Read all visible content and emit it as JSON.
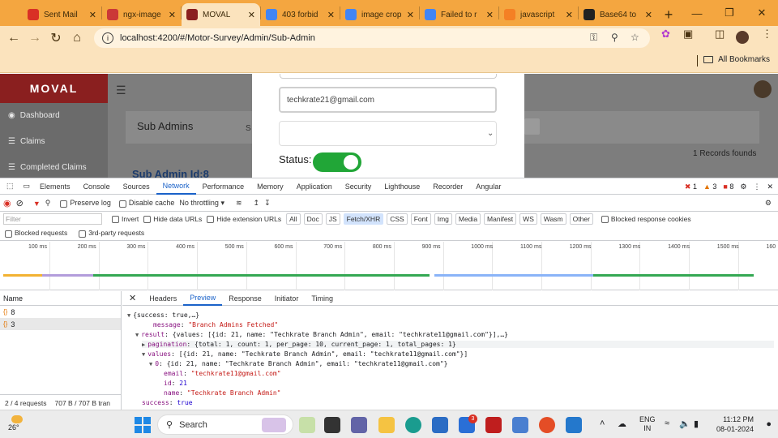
{
  "browser": {
    "tabs": [
      {
        "title": "Sent Mail",
        "icon": "gmail-icon",
        "color": "#d93025"
      },
      {
        "title": "ngx-image",
        "icon": "npm-icon",
        "color": "#cb3837"
      },
      {
        "title": "MOVAL",
        "icon": "moval-icon",
        "color": "#8a1f1f",
        "active": true
      },
      {
        "title": "403 forbid",
        "icon": "google-icon",
        "color": "#4285f4"
      },
      {
        "title": "image crop",
        "icon": "google-icon",
        "color": "#4285f4"
      },
      {
        "title": "Failed to r",
        "icon": "google-icon",
        "color": "#4285f4"
      },
      {
        "title": "javascript",
        "icon": "stackoverflow-icon",
        "color": "#f48024"
      },
      {
        "title": "Base64 to",
        "icon": "panda-icon",
        "color": "#222222"
      }
    ],
    "url": "localhost:4200/#/Motor-Survey/Admin/Sub-Admin",
    "bookmarks_label": "All Bookmarks"
  },
  "app": {
    "logo": "MOVAL",
    "sidebar": [
      "Dashboard",
      "Claims",
      "Completed Claims"
    ],
    "page_title": "Sub Admins",
    "search_prefix": "S",
    "records": "1 Records founds",
    "subadmin_heading": "Sub Admin Id:8",
    "modal": {
      "email_value": "techkrate21@gmail.com",
      "status_label": "Status:",
      "status_on": true
    }
  },
  "devtools": {
    "tabs": [
      "Elements",
      "Console",
      "Sources",
      "Network",
      "Performance",
      "Memory",
      "Application",
      "Security",
      "Lighthouse",
      "Recorder",
      "Angular"
    ],
    "active_tab": "Network",
    "errors": "1",
    "warnings": "3",
    "issues": "8",
    "toolbar": {
      "preserve_log": "Preserve log",
      "disable_cache": "Disable cache",
      "throttling": "No throttling"
    },
    "filter_placeholder": "Filter",
    "filter_opts": [
      "Invert",
      "Hide data URLs",
      "Hide extension URLs"
    ],
    "chips": [
      "All",
      "Doc",
      "JS",
      "Fetch/XHR",
      "CSS",
      "Font",
      "Img",
      "Media",
      "Manifest",
      "WS",
      "Wasm",
      "Other"
    ],
    "active_chip": "Fetch/XHR",
    "blocked_cookies": "Blocked response cookies",
    "blocked_requests": "Blocked requests",
    "third_party": "3rd-party requests",
    "timeline_ticks": [
      "100 ms",
      "200 ms",
      "300 ms",
      "400 ms",
      "500 ms",
      "600 ms",
      "700 ms",
      "800 ms",
      "900 ms",
      "1000 ms",
      "1100 ms",
      "1200 ms",
      "1300 ms",
      "1400 ms",
      "1500 ms",
      "160"
    ],
    "name_header": "Name",
    "requests": [
      "8",
      "3"
    ],
    "footer": {
      "requests": "2 / 4 requests",
      "transferred": "707 B / 707 B tran"
    },
    "detail_tabs": [
      "Headers",
      "Preview",
      "Response",
      "Initiator",
      "Timing"
    ],
    "active_detail": "Preview",
    "preview": {
      "l0": "{success: true,…}",
      "l1_key": "message",
      "l1_val": "\"Branch Admins Fetched\"",
      "l2_key": "result",
      "l2_val": "{values: [{id: 21, name: \"Techkrate Branch Admin\", email: \"techkrate11@gmail.com\"}],…}",
      "l3_key": "pagination",
      "l3_val": "{total: 1, count: 1, per_page: 10, current_page: 1, total_pages: 1}",
      "l4_key": "values",
      "l4_val": "[{id: 21, name: \"Techkrate Branch Admin\", email: \"techkrate11@gmail.com\"}]",
      "l5_key": "0",
      "l5_val": "{id: 21, name: \"Techkrate Branch Admin\", email: \"techkrate11@gmail.com\"}",
      "l6_key": "email",
      "l6_val": "\"techkrate11@gmail.com\"",
      "l7_key": "id",
      "l7_val": "21",
      "l8_key": "name",
      "l8_val": "\"Techkrate Branch Admin\"",
      "l9_key": "success",
      "l9_val": "true"
    }
  },
  "taskbar": {
    "weather": "26°",
    "search": "Search",
    "lang1": "ENG",
    "lang2": "IN",
    "time": "11:12 PM",
    "date": "08-01-2024",
    "badge": "3"
  }
}
